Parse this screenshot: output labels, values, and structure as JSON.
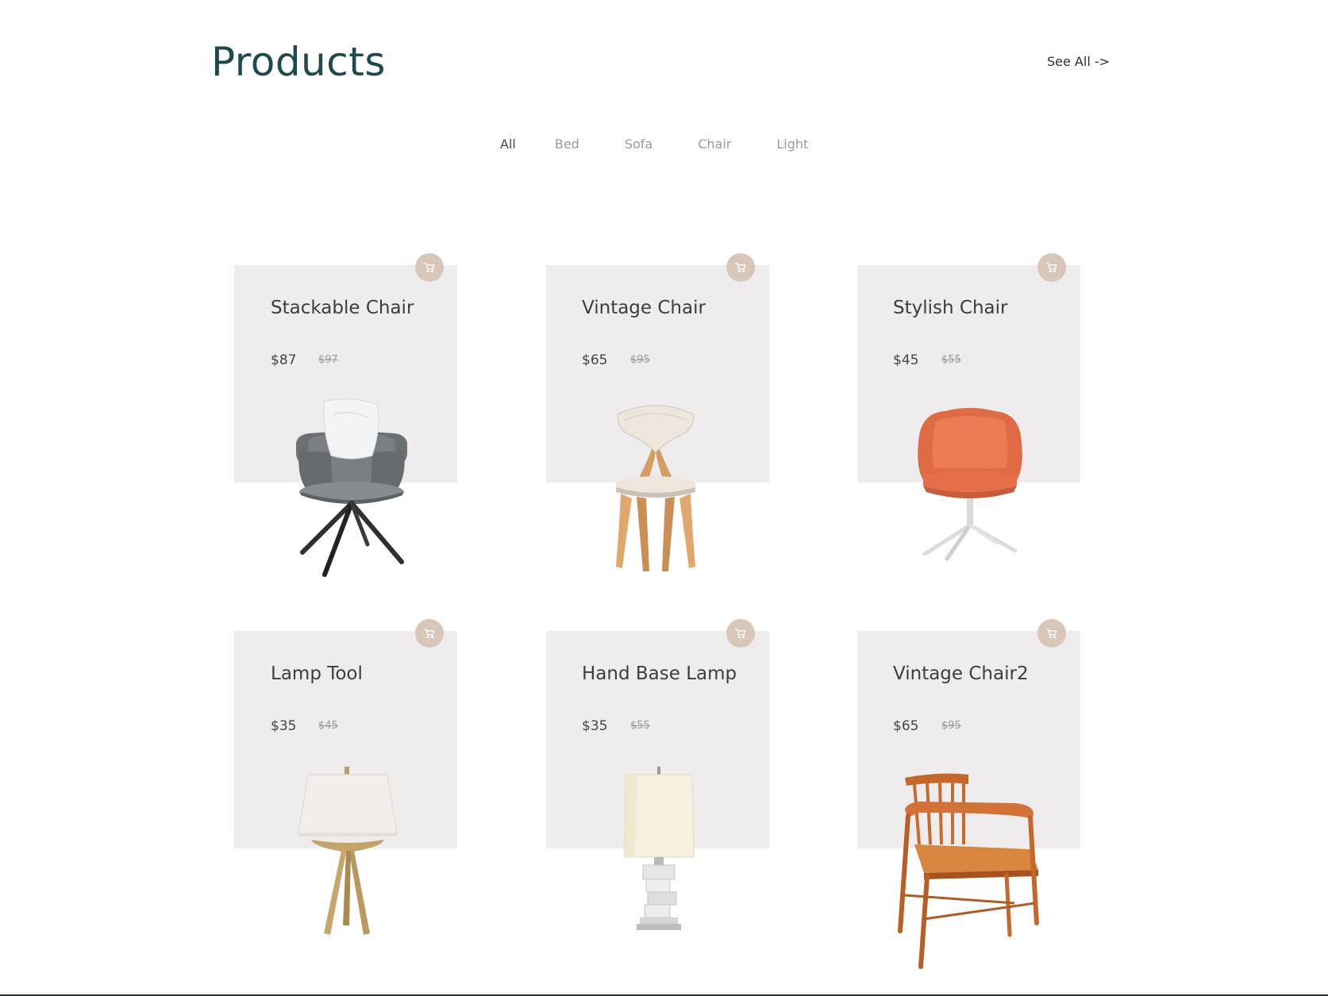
{
  "header": {
    "title": "Products",
    "see_all": "See All ->"
  },
  "filters": [
    {
      "label": "All",
      "active": true
    },
    {
      "label": "Bed",
      "active": false
    },
    {
      "label": "Sofa",
      "active": false
    },
    {
      "label": "Chair",
      "active": false
    },
    {
      "label": "Light",
      "active": false
    }
  ],
  "products": [
    {
      "name": "Stackable Chair",
      "price": "$87",
      "old_price": "$97",
      "image": "gray-armchair-pillow"
    },
    {
      "name": "Vintage Chair",
      "price": "$65",
      "old_price": "$95",
      "image": "wooden-cream-chair"
    },
    {
      "name": "Stylish Chair",
      "price": "$45",
      "old_price": "$55",
      "image": "orange-swivel-chair"
    },
    {
      "name": "Lamp Tool",
      "price": "$35",
      "old_price": "$45",
      "image": "tripod-table-lamp"
    },
    {
      "name": "Hand Base Lamp",
      "price": "$35",
      "old_price": "$55",
      "image": "crystal-base-lamp"
    },
    {
      "name": "Vintage Chair2",
      "price": "$65",
      "old_price": "$95",
      "image": "wooden-spindle-armchair"
    }
  ],
  "colors": {
    "title": "#1f4a4c",
    "card_bg": "#eeeced",
    "cart_button": "#d8c7b9",
    "active_filter": "#4a4a4a",
    "inactive_filter": "#9a9a9a"
  }
}
